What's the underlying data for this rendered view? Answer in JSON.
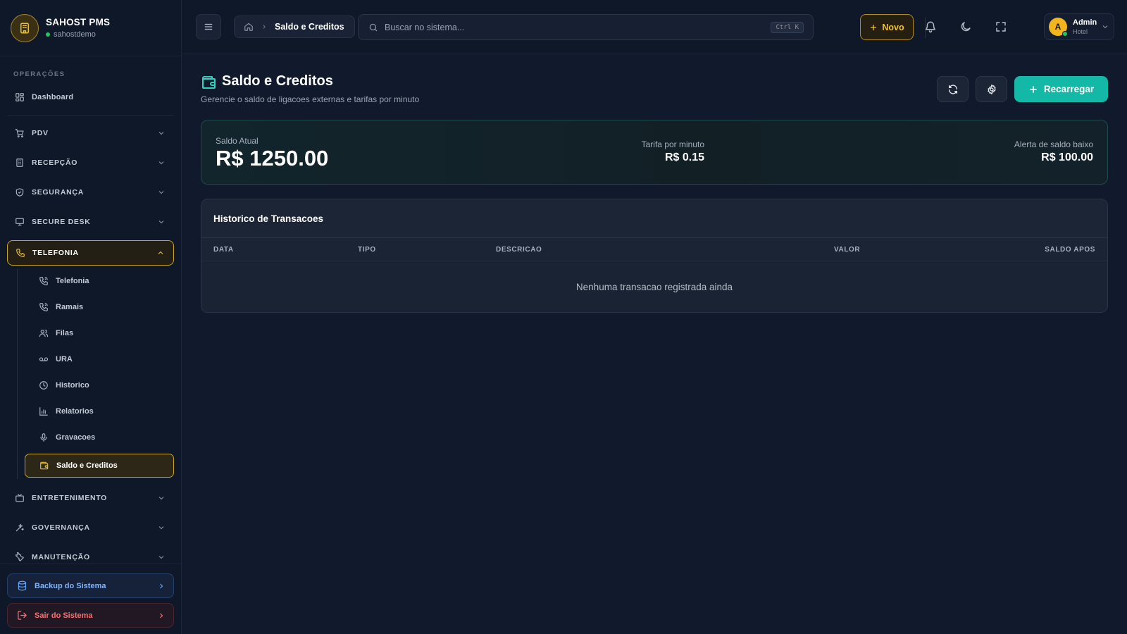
{
  "brand": {
    "name": "SAHOST PMS",
    "subtitle": "sahostdemo"
  },
  "sidebar": {
    "section_label": "OPERAÇÕES",
    "items": [
      {
        "label": "Dashboard",
        "icon": "dashboard-grid-icon"
      },
      {
        "label": "PDV",
        "icon": "cart-icon"
      },
      {
        "label": "RECEPÇÃO",
        "icon": "building-icon"
      },
      {
        "label": "SEGURANÇA",
        "icon": "shield-icon"
      },
      {
        "label": "SECURE DESK",
        "icon": "monitor-icon"
      },
      {
        "label": "TELEFONIA",
        "icon": "phone-icon",
        "expanded": true
      },
      {
        "label": "ENTRETENIMENTO",
        "icon": "tv-icon"
      },
      {
        "label": "GOVERNANÇA",
        "icon": "sparkles-icon"
      },
      {
        "label": "MANUTENÇÃO",
        "icon": "wrench-icon"
      }
    ],
    "telefonia_sub": [
      {
        "label": "Telefonia",
        "icon": "phone-call-icon"
      },
      {
        "label": "Ramais",
        "icon": "phone-call-icon"
      },
      {
        "label": "Filas",
        "icon": "users-icon"
      },
      {
        "label": "URA",
        "icon": "voicemail-icon"
      },
      {
        "label": "Historico",
        "icon": "clock-icon"
      },
      {
        "label": "Relatorios",
        "icon": "bar-chart-icon"
      },
      {
        "label": "Gravacoes",
        "icon": "microphone-icon"
      },
      {
        "label": "Saldo e Creditos",
        "icon": "wallet-icon",
        "active": true
      }
    ],
    "backup_label": "Backup do Sistema",
    "logout_label": "Sair do Sistema"
  },
  "topbar": {
    "breadcrumb_current": "Saldo e Creditos",
    "search_placeholder": "Buscar no sistema...",
    "search_shortcut": "Ctrl K",
    "new_label": "Novo",
    "user_initial": "A",
    "user_name": "Admin",
    "user_role": "Hotel"
  },
  "page": {
    "title": "Saldo e Creditos",
    "subtitle": "Gerencie o saldo de ligacoes externas e tarifas por minuto",
    "recharge_label": "Recarregar"
  },
  "balance": {
    "current_label": "Saldo Atual",
    "current_value": "R$ 1250.00",
    "rate_label": "Tarifa por minuto",
    "rate_value": "R$ 0.15",
    "alert_label": "Alerta de saldo baixo",
    "alert_value": "R$ 100.00"
  },
  "transactions": {
    "title": "Historico de Transacoes",
    "columns": [
      "DATA",
      "TIPO",
      "DESCRICAO",
      "VALOR",
      "SALDO APOS"
    ],
    "empty_message": "Nenhuma transacao registrada ainda"
  },
  "colors": {
    "accent_gold": "#c9a227",
    "accent_teal": "#14b8a6",
    "background": "#111a2c",
    "sidebar": "#0f1829"
  }
}
